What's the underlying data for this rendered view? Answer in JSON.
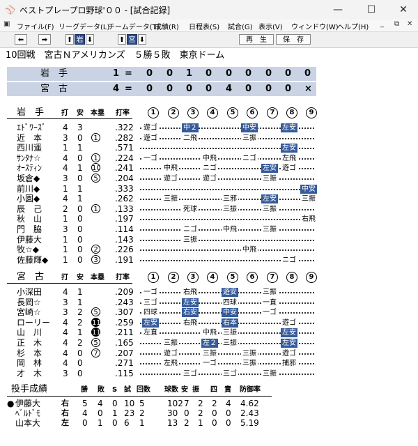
{
  "window": {
    "title": "ベストプレープロ野球'００ - [試合記録]",
    "minimize_icon": "minimize-icon",
    "maximize_icon": "maximize-icon",
    "close_icon": "close-icon"
  },
  "menu": {
    "items": [
      "ファイル(F)",
      "リーグデータ(L)",
      "チームデータ(T)",
      "成績(R)",
      "日程表(S)",
      "試合(G)",
      "表示(V)",
      "ウィンドウ(W)",
      "ヘルプ(H)"
    ]
  },
  "toolbar": {
    "team1": "岩",
    "team2": "宮",
    "play": "再　生",
    "save": "保　存"
  },
  "game": {
    "header": "10回戦　宮古Ｎアメリカンズ　５勝５敗　東京ドーム"
  },
  "scoreboard": [
    {
      "team": "岩　手",
      "runs": "1",
      "innings": [
        "0",
        "0",
        "1",
        "0",
        "0",
        "0",
        "0",
        "0",
        "0"
      ]
    },
    {
      "team": "宮　古",
      "runs": "4",
      "innings": [
        "0",
        "0",
        "0",
        "0",
        "4",
        "0",
        "0",
        "0",
        "×"
      ]
    }
  ],
  "batting_headers": {
    "h_da": "打",
    "h_an": "安",
    "h_hr": "本塁",
    "h_avg": "打率"
  },
  "innings_labels": [
    "1",
    "2",
    "3",
    "4",
    "5",
    "6",
    "7",
    "8",
    "9"
  ],
  "team1": {
    "name": "岩　手",
    "players": [
      {
        "name": "ｴﾄﾞﾜｰｽﾞ",
        "ab": "4",
        "h": "3",
        "hr": "",
        "avg": ".322",
        "r": [
          "遊ゴ",
          "",
          "中２",
          "",
          "",
          "中安",
          "",
          "左安",
          ""
        ]
      },
      {
        "name": "近　本",
        "ab": "3",
        "h": "0",
        "hr": "1",
        "avg": ".282",
        "r": [
          "遊ゴ",
          "",
          "二飛",
          "",
          "",
          "三振",
          "",
          "",
          ""
        ]
      },
      {
        "name": "西川遥",
        "ab": "1",
        "h": "1",
        "hr": "",
        "avg": ".571",
        "r": [
          "",
          "",
          "",
          "",
          "",
          "",
          "",
          "左安",
          ""
        ]
      },
      {
        "name": "ｻﾝﾀﾅ☆",
        "ab": "4",
        "h": "0",
        "hr": "1",
        "avg": ".224",
        "r": [
          "一ゴ",
          "",
          "",
          "中飛",
          "",
          "ニゴ",
          "",
          "左飛",
          ""
        ]
      },
      {
        "name": "ｵｰｽﾃｨﾝ",
        "ab": "4",
        "h": "1",
        "hr": "10",
        "avg": ".241",
        "r": [
          "",
          "中飛",
          "",
          "ニゴ",
          "",
          "",
          "左安",
          "遊ゴ",
          ""
        ]
      },
      {
        "name": "坂倉◆",
        "ab": "3",
        "h": "0",
        "hr": "5",
        "avg": ".204",
        "r": [
          "",
          "遊ゴ",
          "",
          "遊ゴ",
          "",
          "",
          "三振",
          "",
          ""
        ]
      },
      {
        "name": "前川◆",
        "ab": "1",
        "h": "1",
        "hr": "",
        "avg": ".333",
        "r": [
          "",
          "",
          "",
          "",
          "",
          "",
          "",
          "",
          "中安"
        ]
      },
      {
        "name": "小園◆",
        "ab": "4",
        "h": "1",
        "hr": "",
        "avg": ".262",
        "r": [
          "",
          "三振",
          "",
          "",
          "三邪",
          "",
          "左安",
          "",
          "三振"
        ]
      },
      {
        "name": "辰　己",
        "ab": "2",
        "h": "0",
        "hr": "1",
        "avg": ".133",
        "r": [
          "",
          "",
          "死球",
          "",
          "三振",
          "",
          "三振",
          "",
          ""
        ]
      },
      {
        "name": "秋　山",
        "ab": "1",
        "h": "0",
        "hr": "",
        "avg": ".197",
        "r": [
          "",
          "",
          "",
          "",
          "",
          "",
          "",
          "",
          "右飛"
        ]
      },
      {
        "name": "門　脇",
        "ab": "3",
        "h": "0",
        "hr": "",
        "avg": ".114",
        "r": [
          "",
          "",
          "ニゴ",
          "",
          "中飛",
          "",
          "三振",
          "",
          ""
        ]
      },
      {
        "name": "伊藤大",
        "ab": "1",
        "h": "0",
        "hr": "",
        "avg": ".143",
        "r": [
          "",
          "",
          "三振",
          "",
          "",
          "",
          "",
          "",
          ""
        ]
      },
      {
        "name": "牧☆◆",
        "ab": "1",
        "h": "0",
        "hr": "2",
        "avg": ".226",
        "r": [
          "",
          "",
          "",
          "",
          "",
          "中飛",
          "",
          "",
          ""
        ]
      },
      {
        "name": "佐藤輝◆",
        "ab": "1",
        "h": "0",
        "hr": "3",
        "avg": ".191",
        "r": [
          "",
          "",
          "",
          "",
          "",
          "",
          "",
          "ニゴ",
          ""
        ]
      }
    ]
  },
  "team2": {
    "name": "宮　古",
    "players": [
      {
        "name": "小深田",
        "ab": "4",
        "h": "1",
        "hr": "",
        "avg": ".209",
        "r": [
          "一ゴ",
          "",
          "右飛",
          "",
          "遊安",
          "",
          "三振",
          "",
          ""
        ]
      },
      {
        "name": "長岡☆",
        "ab": "3",
        "h": "1",
        "hr": "",
        "avg": ".243",
        "r": [
          "三ゴ",
          "",
          "左安",
          "",
          "四球",
          "",
          "一直",
          "",
          ""
        ]
      },
      {
        "name": "宮崎☆",
        "ab": "3",
        "h": "2",
        "hr": "5",
        "avg": ".307",
        "r": [
          "四球",
          "",
          "右安",
          "",
          "中安",
          "",
          "一ゴ",
          "",
          ""
        ]
      },
      {
        "name": "ローリー",
        "ab": "4",
        "h": "2",
        "hr": "11",
        "avg": ".259",
        "r": [
          "左安",
          "",
          "右飛",
          "",
          "右本",
          "",
          "",
          "遊ゴ",
          ""
        ]
      },
      {
        "name": "山　川",
        "ab": "4",
        "h": "1",
        "hr": "11",
        "avg": ".211",
        "r": [
          "左直",
          "",
          "",
          "中飛",
          "三振",
          "",
          "",
          "左安",
          ""
        ]
      },
      {
        "name": "正　木",
        "ab": "4",
        "h": "2",
        "hr": "5",
        "avg": ".165",
        "r": [
          "",
          "三振",
          "",
          "左２",
          "三振",
          "",
          "",
          "左安",
          ""
        ]
      },
      {
        "name": "杉　本",
        "ab": "4",
        "h": "0",
        "hr": "7",
        "avg": ".207",
        "r": [
          "",
          "遊ゴ",
          "",
          "三振",
          "",
          "三振",
          "",
          "遊ゴ",
          ""
        ]
      },
      {
        "name": "岡　林",
        "ab": "4",
        "h": "0",
        "hr": "",
        "avg": ".271",
        "r": [
          "",
          "左飛",
          "",
          "一ゴ",
          "",
          "三振",
          "",
          "捕邪",
          ""
        ]
      },
      {
        "name": "才　木",
        "ab": "3",
        "h": "0",
        "hr": "",
        "avg": ".115",
        "r": [
          "",
          "",
          "三ゴ",
          "",
          "三ゴ",
          "",
          "三振",
          "",
          ""
        ]
      }
    ]
  },
  "pitching": {
    "title": "投手成績",
    "headers": [
      "勝",
      "敗",
      "S",
      "試",
      "回数",
      "球数",
      "安",
      "振",
      "四",
      "責",
      "防御率"
    ],
    "rows": [
      {
        "mark": "●",
        "name": "伊藤大",
        "hand": "右",
        "w": "5",
        "l": "4",
        "s": "0",
        "g": "10",
        "ip": "5",
        "np": "102",
        "h": "7",
        "k": "2",
        "bb": "2",
        "er": "4",
        "era": "4.62"
      },
      {
        "mark": "",
        "name": "ﾍﾞﾙﾄﾞﾓ",
        "hand": "右",
        "w": "4",
        "l": "0",
        "s": "1",
        "g": "23",
        "ip": "2",
        "np": "30",
        "h": "0",
        "k": "2",
        "bb": "0",
        "er": "0",
        "era": "2.43"
      },
      {
        "mark": "",
        "name": "山本大",
        "hand": "左",
        "w": "0",
        "l": "1",
        "s": "0",
        "g": "6",
        "ip": "1",
        "np": "13",
        "h": "2",
        "k": "1",
        "bb": "0",
        "er": "0",
        "era": "5.19"
      }
    ]
  },
  "colors": {
    "accent": "#355b9b",
    "scoreboard_bg": "#c9d3e3"
  }
}
